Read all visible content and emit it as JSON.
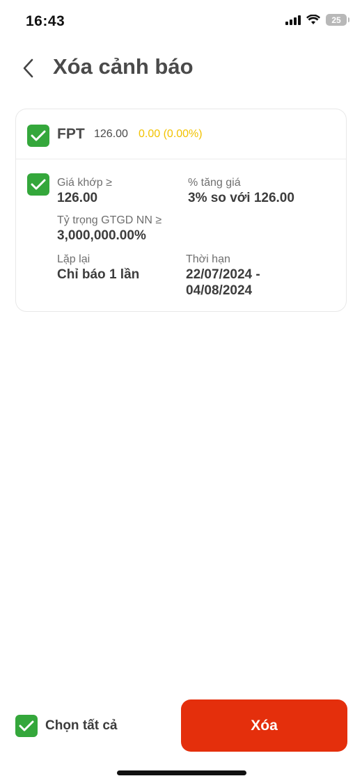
{
  "status": {
    "time": "16:43",
    "battery": "25"
  },
  "header": {
    "title": "Xóa cảnh báo"
  },
  "alert": {
    "symbol": "FPT",
    "price": "126.00",
    "change": "0.00 (0.00%)",
    "match_price_label": "Giá khớp ≥",
    "match_price_value": "126.00",
    "increase_label": "% tăng giá",
    "increase_value": "3% so với 126.00",
    "foreign_ratio_label": "Tỷ trọng GTGD NN ≥",
    "foreign_ratio_value": "3,000,000.00%",
    "repeat_label": "Lặp lại",
    "repeat_value": "Chỉ báo 1 lần",
    "duration_label": "Thời hạn",
    "duration_value_line1": "22/07/2024 -",
    "duration_value_line2": "04/08/2024"
  },
  "footer": {
    "select_all_label": "Chọn tất cả",
    "delete_label": "Xóa"
  },
  "colors": {
    "checkbox": "#34a73b",
    "change": "#f2c200",
    "delete_button": "#e42f0c"
  }
}
